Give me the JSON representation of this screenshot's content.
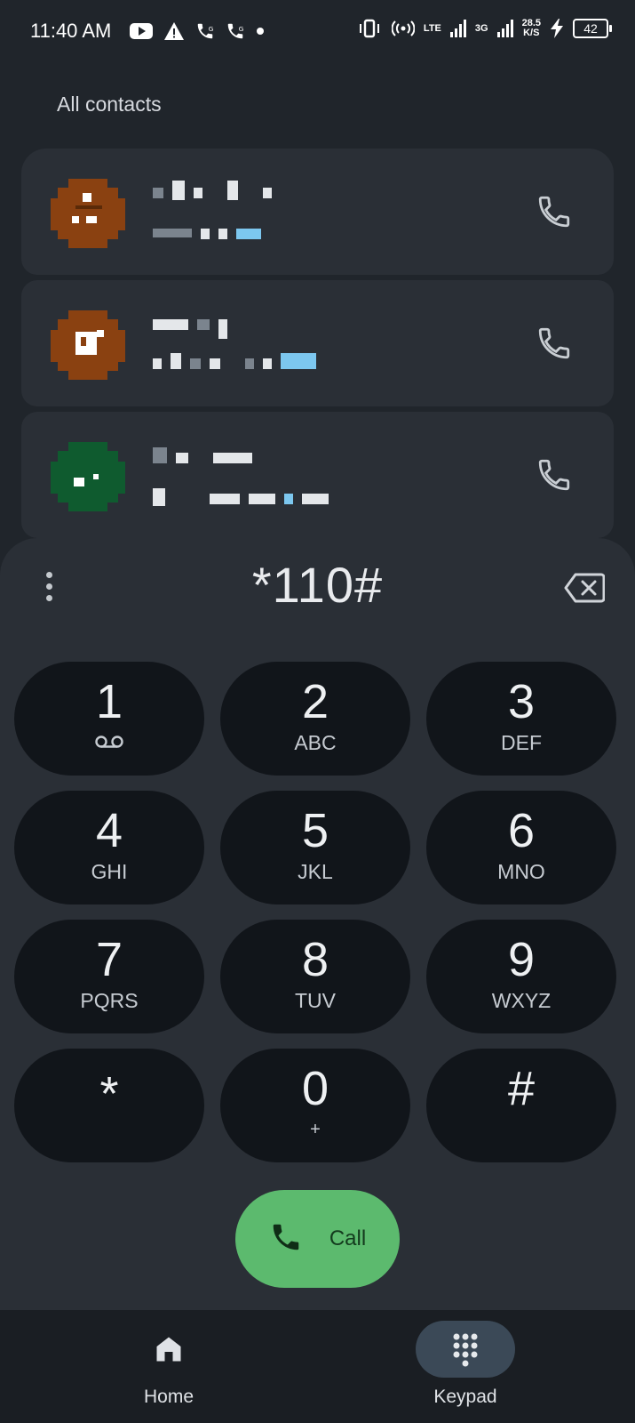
{
  "status_bar": {
    "time": "11:40 AM",
    "network_1": "LTE",
    "network_2": "3G",
    "speed_value": "28.5",
    "speed_unit": "K/S",
    "battery": "42"
  },
  "contacts": {
    "section_title": "All contacts",
    "items": [
      {
        "avatar_color": "#8a4111",
        "avatar_icon": "pixelated-avatar"
      },
      {
        "avatar_color": "#8a4111",
        "avatar_icon": "pixelated-avatar"
      },
      {
        "avatar_color": "#0f5b2f",
        "avatar_icon": "pixelated-avatar"
      }
    ]
  },
  "dialer": {
    "input_value": "*110#",
    "keys": [
      {
        "digit": "1",
        "letters": ""
      },
      {
        "digit": "2",
        "letters": "ABC"
      },
      {
        "digit": "3",
        "letters": "DEF"
      },
      {
        "digit": "4",
        "letters": "GHI"
      },
      {
        "digit": "5",
        "letters": "JKL"
      },
      {
        "digit": "6",
        "letters": "MNO"
      },
      {
        "digit": "7",
        "letters": "PQRS"
      },
      {
        "digit": "8",
        "letters": "TUV"
      },
      {
        "digit": "9",
        "letters": "WXYZ"
      },
      {
        "digit": "*",
        "letters": ""
      },
      {
        "digit": "0",
        "letters": "+"
      },
      {
        "digit": "#",
        "letters": ""
      }
    ],
    "call_label": "Call",
    "call_color": "#5cba6e"
  },
  "bottom_nav": {
    "items": [
      {
        "label": "Home",
        "icon": "home-icon",
        "active": false
      },
      {
        "label": "Keypad",
        "icon": "dialpad-icon",
        "active": true
      }
    ]
  }
}
